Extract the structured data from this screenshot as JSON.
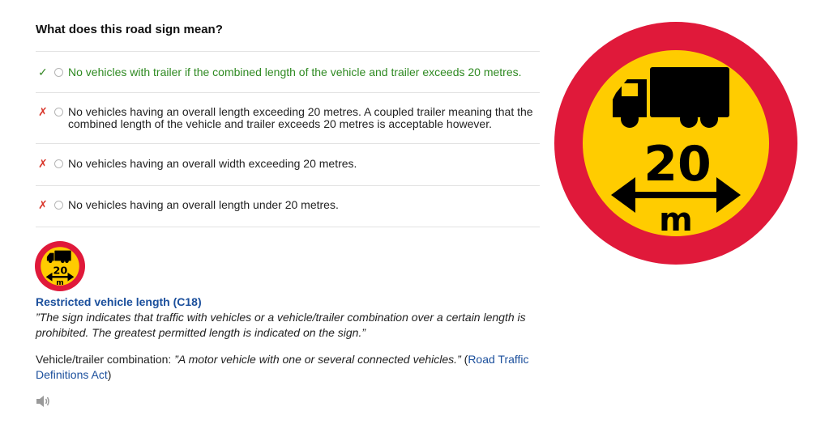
{
  "question": "What does this road sign mean?",
  "answers": [
    {
      "mark": "✓",
      "text": "No vehicles with trailer if the combined length of the vehicle and trailer exceeds 20 metres.",
      "correct": true
    },
    {
      "mark": "✗",
      "text": "No vehicles having an overall length exceeding 20 metres. A coupled trailer meaning that the combined length of the vehicle and trailer exceeds 20 metres is acceptable however.",
      "correct": false
    },
    {
      "mark": "✗",
      "text": "No vehicles having an overall width exceeding 20 metres.",
      "correct": false
    },
    {
      "mark": "✗",
      "text": "No vehicles having an overall length under 20 metres.",
      "correct": false
    }
  ],
  "sign": {
    "number": "20",
    "unit": "m",
    "colors": {
      "ring": "#e0193a",
      "fill": "#ffcc00",
      "symbol": "#000000"
    }
  },
  "explanation": {
    "title": "Restricted vehicle length (C18)",
    "quote": "”The sign indicates that traffic with vehicles or a vehicle/trailer combination over a certain length is prohibited. The greatest permitted length is indicated on the sign.”",
    "definition_prefix": "Vehicle/trailer combination: ",
    "definition_quote": "”A motor vehicle with one or several connected vehicles.”",
    "definition_open": " (",
    "definition_link": "Road Traffic Definitions Act",
    "definition_close": ")"
  },
  "icons": {
    "audio": "speaker-icon"
  }
}
